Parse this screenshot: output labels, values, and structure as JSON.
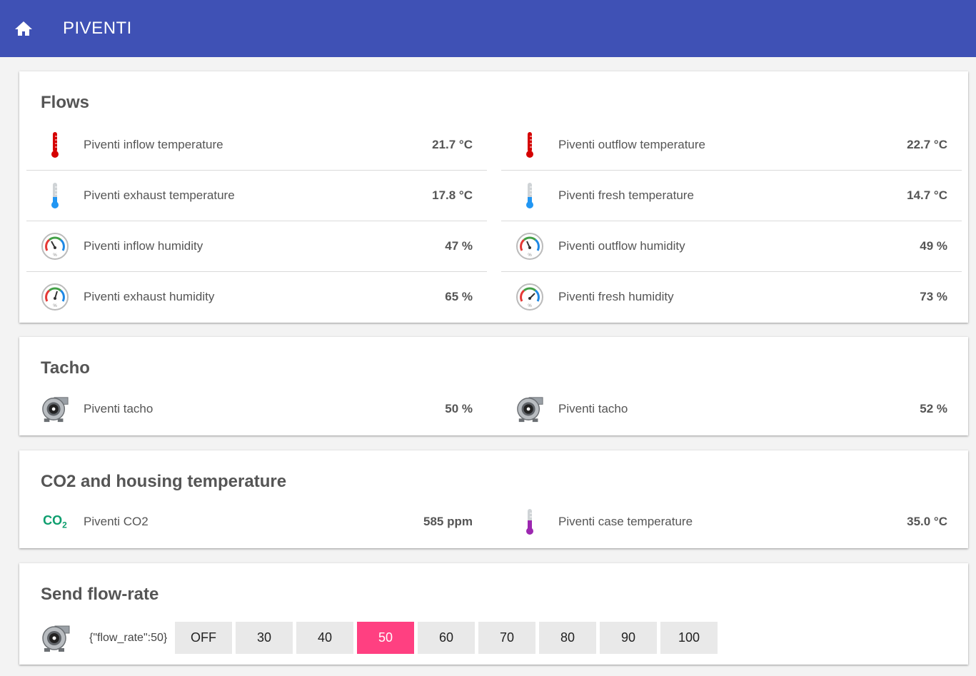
{
  "app": {
    "title": "PIVENTI"
  },
  "flows": {
    "title": "Flows",
    "left": [
      {
        "label": "Piventi inflow temperature",
        "value": "21.7 °C",
        "icon": "thermometer-hot-icon"
      },
      {
        "label": "Piventi exhaust temperature",
        "value": "17.8 °C",
        "icon": "thermometer-cold-icon"
      },
      {
        "label": "Piventi inflow humidity",
        "value": "47 %",
        "icon": "humidity-gauge-icon"
      },
      {
        "label": "Piventi exhaust humidity",
        "value": "65 %",
        "icon": "humidity-gauge-icon"
      }
    ],
    "right": [
      {
        "label": "Piventi outflow temperature",
        "value": "22.7 °C",
        "icon": "thermometer-hot-icon"
      },
      {
        "label": "Piventi fresh temperature",
        "value": "14.7 °C",
        "icon": "thermometer-cold-icon"
      },
      {
        "label": "Piventi outflow humidity",
        "value": "49 %",
        "icon": "humidity-gauge-icon"
      },
      {
        "label": "Piventi fresh humidity",
        "value": "73 %",
        "icon": "humidity-gauge-icon"
      }
    ]
  },
  "tacho": {
    "title": "Tacho",
    "left": {
      "label": "Piventi tacho",
      "value": "50 %",
      "icon": "fan-icon"
    },
    "right": {
      "label": "Piventi tacho",
      "value": "52 %",
      "icon": "fan-icon"
    }
  },
  "co2": {
    "title": "CO2 and housing temperature",
    "left": {
      "label": "Piventi CO2",
      "value": "585 ppm",
      "icon_text": "CO",
      "icon_sub": "2"
    },
    "right": {
      "label": "Piventi case temperature",
      "value": "35.0 °C",
      "icon": "thermometer-purple-icon"
    }
  },
  "flowrate": {
    "title": "Send flow-rate",
    "payload": "{\"flow_rate\":50}",
    "buttons": [
      "OFF",
      "30",
      "40",
      "50",
      "60",
      "70",
      "80",
      "90",
      "100"
    ],
    "selected": "50",
    "colors": {
      "accent": "#ff4081",
      "header": "#3f51b5"
    }
  }
}
